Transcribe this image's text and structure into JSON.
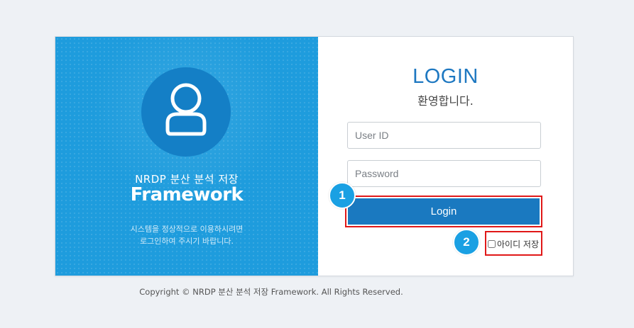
{
  "brand": {
    "subtitle": "NRDP 분산 분석 저장",
    "title": "Framework",
    "description_line1": "시스템을 정상적으로 이용하시려면",
    "description_line2": "로그인하여 주시기 바랍니다."
  },
  "login": {
    "heading": "LOGIN",
    "welcome": "환영합니다.",
    "user_id_placeholder": "User ID",
    "password_placeholder": "Password",
    "submit_label": "Login",
    "remember_label": "아이디 저장"
  },
  "annotations": {
    "badge_1": "1",
    "badge_2": "2",
    "highlight_color": "#e01818",
    "badge_color": "#1aa0e3"
  },
  "footer": {
    "copyright": "Copyright © NRDP 분산 분석 저장 Framework. All Rights Reserved."
  },
  "colors": {
    "brand_panel": "#1e9cdd",
    "button": "#1a79c0",
    "heading": "#1e78c1"
  }
}
